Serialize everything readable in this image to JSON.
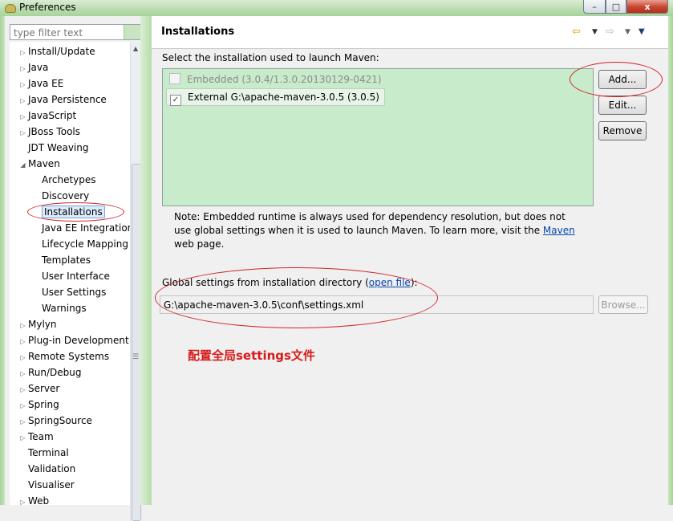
{
  "window": {
    "title": "Preferences",
    "close_glyph": "x",
    "min_glyph": "–",
    "max_glyph": "□"
  },
  "filter": {
    "placeholder": "type filter text"
  },
  "tree": [
    {
      "label": "Install/Update",
      "expander": true,
      "indent": 0
    },
    {
      "label": "Java",
      "expander": true,
      "indent": 0
    },
    {
      "label": "Java EE",
      "expander": true,
      "indent": 0
    },
    {
      "label": "Java Persistence",
      "expander": true,
      "indent": 0
    },
    {
      "label": "JavaScript",
      "expander": true,
      "indent": 0
    },
    {
      "label": "JBoss Tools",
      "expander": true,
      "indent": 0
    },
    {
      "label": "JDT Weaving",
      "expander": false,
      "indent": 0
    },
    {
      "label": "Maven",
      "expander": true,
      "expanded": true,
      "indent": 0
    },
    {
      "label": "Archetypes",
      "indent": 1
    },
    {
      "label": "Discovery",
      "indent": 1
    },
    {
      "label": "Installations",
      "indent": 1,
      "selected": true
    },
    {
      "label": "Java EE Integration",
      "indent": 1
    },
    {
      "label": "Lifecycle Mapping",
      "indent": 1
    },
    {
      "label": "Templates",
      "indent": 1
    },
    {
      "label": "User Interface",
      "indent": 1
    },
    {
      "label": "User Settings",
      "indent": 1
    },
    {
      "label": "Warnings",
      "indent": 1
    },
    {
      "label": "Mylyn",
      "expander": true,
      "indent": 0
    },
    {
      "label": "Plug-in Development",
      "expander": true,
      "indent": 0
    },
    {
      "label": "Remote Systems",
      "expander": true,
      "indent": 0
    },
    {
      "label": "Run/Debug",
      "expander": true,
      "indent": 0
    },
    {
      "label": "Server",
      "expander": true,
      "indent": 0
    },
    {
      "label": "Spring",
      "expander": true,
      "indent": 0
    },
    {
      "label": "SpringSource",
      "expander": true,
      "indent": 0
    },
    {
      "label": "Team",
      "expander": true,
      "indent": 0
    },
    {
      "label": "Terminal",
      "expander": false,
      "indent": 0
    },
    {
      "label": "Validation",
      "expander": false,
      "indent": 0
    },
    {
      "label": "Visualiser",
      "expander": false,
      "indent": 0
    },
    {
      "label": "Web",
      "expander": true,
      "indent": 0
    }
  ],
  "page": {
    "title": "Installations",
    "prompt": "Select the installation used to launch Maven:",
    "installations": [
      {
        "label": "Embedded (3.0.4/1.3.0.20130129-0421)",
        "checked": false,
        "disabled": true
      },
      {
        "label": "External G:\\apache-maven-3.0.5 (3.0.5)",
        "checked": true,
        "disabled": false
      }
    ],
    "buttons": {
      "add": "Add...",
      "edit": "Edit...",
      "remove": "Remove",
      "browse": "Browse..."
    },
    "note_before": "Note: Embedded runtime is always used for dependency resolution, but does not use global settings when it is used to launch Maven. To learn more, visit the ",
    "note_link": "Maven",
    "note_after": " web page.",
    "global_label_before": "Global settings from installation directory (",
    "global_link": "open file",
    "global_label_after": "):",
    "global_path": "G:\\apache-maven-3.0.5\\conf\\settings.xml",
    "annotation": "配置全局settings文件"
  },
  "colors": {
    "annotation": "#d81a1a",
    "list_bg": "#c8ebcb",
    "link": "#0645ad"
  },
  "icons": [
    "back-arrow-icon",
    "forward-arrow-icon",
    "view-menu-icon",
    "check-icon",
    "chevron-down-icon"
  ]
}
